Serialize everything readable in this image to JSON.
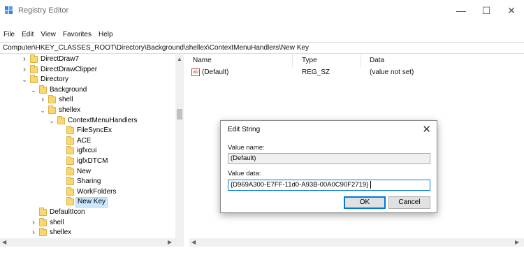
{
  "window": {
    "title": "Registry Editor",
    "minimize_glyph": "—",
    "maximize_glyph": "☐",
    "close_glyph": "✕"
  },
  "menu": [
    "File",
    "Edit",
    "View",
    "Favorites",
    "Help"
  ],
  "address": "Computer\\HKEY_CLASSES_ROOT\\Directory\\Background\\shellex\\ContextMenuHandlers\\New Key",
  "tree": [
    {
      "label": "DirectDraw7",
      "depth": 0,
      "state": "collapsed"
    },
    {
      "label": "DirectDrawClipper",
      "depth": 0,
      "state": "collapsed"
    },
    {
      "label": "Directory",
      "depth": 0,
      "state": "expanded"
    },
    {
      "label": "Background",
      "depth": 1,
      "state": "expanded"
    },
    {
      "label": "shell",
      "depth": 2,
      "state": "collapsed"
    },
    {
      "label": "shellex",
      "depth": 2,
      "state": "expanded"
    },
    {
      "label": "ContextMenuHandlers",
      "depth": 3,
      "state": "expanded"
    },
    {
      "label": "FileSyncEx",
      "depth": 4,
      "state": "leaf"
    },
    {
      "label": "ACE",
      "depth": 4,
      "state": "leaf"
    },
    {
      "label": "igfxcui",
      "depth": 4,
      "state": "leaf"
    },
    {
      "label": "igfxDTCM",
      "depth": 4,
      "state": "leaf"
    },
    {
      "label": "New",
      "depth": 4,
      "state": "leaf"
    },
    {
      "label": "Sharing",
      "depth": 4,
      "state": "leaf"
    },
    {
      "label": "WorkFolders",
      "depth": 4,
      "state": "leaf"
    },
    {
      "label": "New Key",
      "depth": 4,
      "state": "leaf",
      "selected": true
    },
    {
      "label": "DefaultIcon",
      "depth": 1,
      "state": "leaf"
    },
    {
      "label": "shell",
      "depth": 1,
      "state": "collapsed"
    },
    {
      "label": "shellex",
      "depth": 1,
      "state": "collapsed"
    }
  ],
  "list": {
    "columns": [
      "Name",
      "Type",
      "Data"
    ],
    "rows": [
      {
        "icon": "ab",
        "name": "(Default)",
        "type": "REG_SZ",
        "data": "(value not set)"
      }
    ]
  },
  "dialog": {
    "title": "Edit String",
    "value_name_label": "Value name:",
    "value_name": "(Default)",
    "value_data_label": "Value data:",
    "value_data": "{D969A300-E7FF-11d0-A93B-00A0C90F2719}",
    "ok_label": "OK",
    "cancel_label": "Cancel"
  },
  "colors": {
    "selection": "#cce8ff",
    "focus_border": "#0078d7",
    "folder": "#f8d775"
  }
}
